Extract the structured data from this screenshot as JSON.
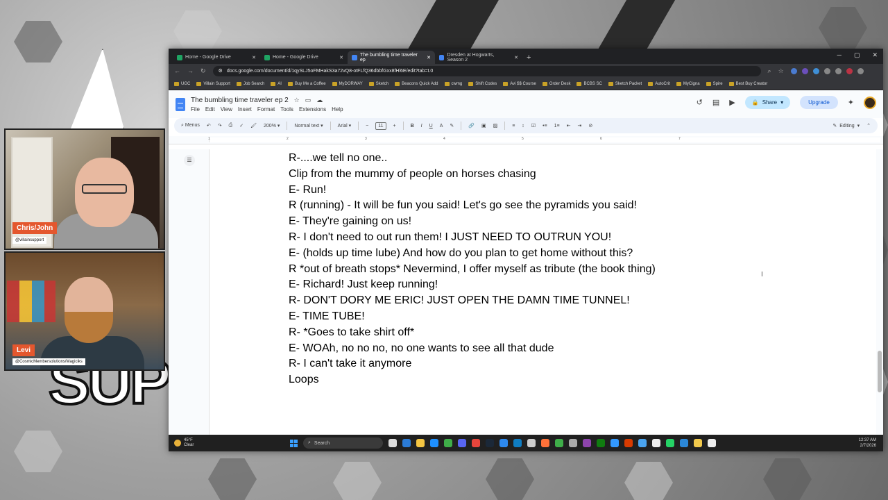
{
  "browser": {
    "tabs": [
      {
        "label": "Home - Google Drive",
        "color": "#1fa463"
      },
      {
        "label": "Home - Google Drive",
        "color": "#1fa463"
      },
      {
        "label": "The bumbling time traveler ep",
        "color": "#4285f4"
      },
      {
        "label": "Dresden at Hogwarts, Season 2",
        "color": "#4285f4"
      }
    ],
    "url": "docs.google.com/document/d/1qySLJ5oFMHakS3a72vQ8-otFLfQ36dbbfGxx8fHl6E/edit?tab=t.0",
    "bookmarks": [
      "UGC",
      "Villain Support",
      "Job Search",
      "AI",
      "Buy Me a Coffee",
      "MyDORWAY",
      "Sketch",
      "Beacons Quick Add",
      "cwmg",
      "Shift Codes",
      "Avi $$ Course",
      "Order Desk",
      "BCBS SC",
      "Sketch Packet",
      "AutoCrit",
      "MyCigna",
      "Spire",
      "Best Buy Creator"
    ]
  },
  "docs": {
    "title": "The bumbling time traveler ep 2",
    "menus": [
      "File",
      "Edit",
      "View",
      "Insert",
      "Format",
      "Tools",
      "Extensions",
      "Help"
    ],
    "share_label": "Share",
    "upgrade_label": "Upgrade",
    "toolbar": {
      "menus_label": "Menus",
      "zoom": "200%",
      "style": "Normal text",
      "font": "Arial",
      "font_size": "11",
      "mode": "Editing"
    },
    "ruler_marks": [
      "1",
      "2",
      "3",
      "4",
      "5",
      "6",
      "7"
    ],
    "lines": [
      "R-....we tell no one..",
      "Clip from the mummy of people on horses chasing",
      "E- Run!",
      "R (running) - It will be fun you said! Let's go see the pyramids you said!",
      "E- They're gaining on us!",
      "R- I don't need to out run them! I JUST NEED TO OUTRUN YOU!",
      "E- (holds up time lube) And how do you plan to get home without this?",
      "R *out of breath stops* Nevermind, I offer myself as tribute (the book thing)",
      "E- Richard! Just keep running!",
      "R- DON'T DORY ME ERIC! JUST OPEN THE DAMN TIME TUNNEL!",
      "E- TIME TUBE!",
      "R- *Goes to take shirt off*",
      "E- WOAh, no no no, no one wants to see all that dude",
      "R- I can't take it anymore",
      "Loops"
    ]
  },
  "taskbar": {
    "temp": "45°F",
    "weather": "Clear",
    "search_placeholder": "Search",
    "time": "12:37 AM",
    "date": "2/7/2026"
  },
  "stream": {
    "cam1_name": "Chris/John",
    "cam1_handle": "@villainsupport",
    "cam2_name": "Levi",
    "cam2_handle": "@CosmicMembersolutions/Magiciks",
    "bg_text": "SUPP"
  }
}
